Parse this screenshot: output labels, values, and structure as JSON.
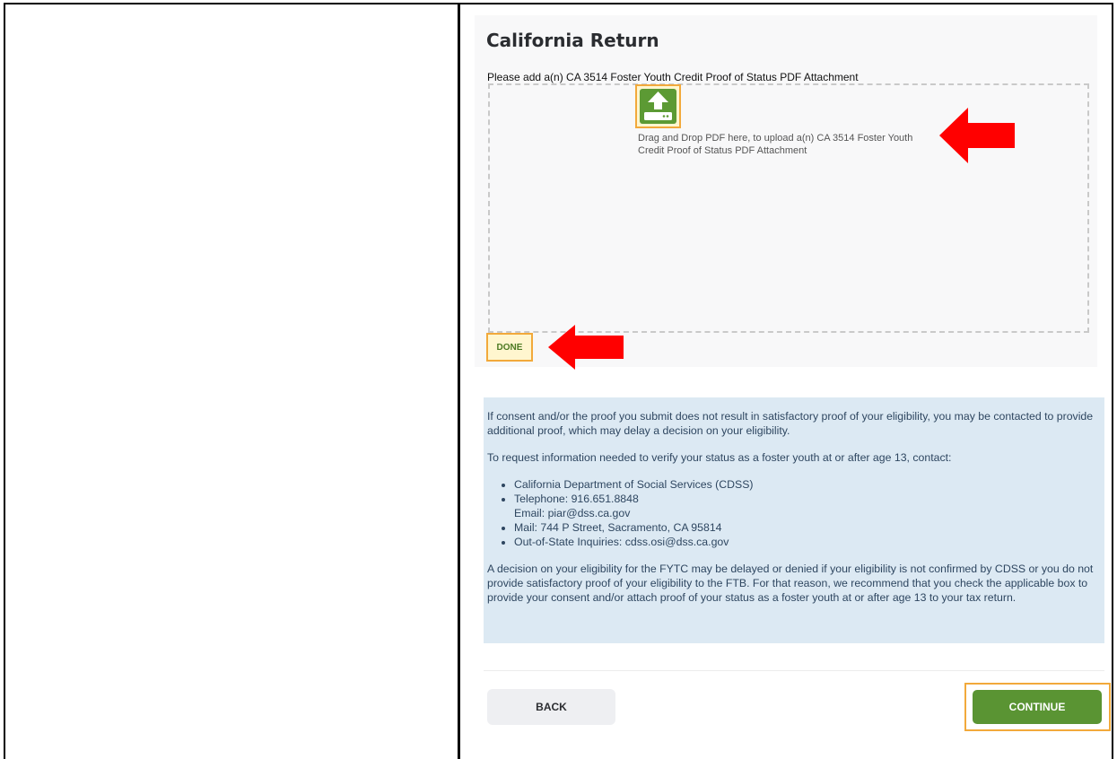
{
  "page": {
    "title": "California Return",
    "instruction": "Please add a(n) CA 3514 Foster Youth Credit Proof of Status PDF Attachment"
  },
  "upload": {
    "icon": "upload-icon",
    "drop_text": "Drag and Drop PDF here, to upload a(n) CA 3514 Foster Youth Credit Proof of Status PDF Attachment",
    "done_label": "DONE"
  },
  "info": {
    "paragraph1": "If consent and/or the proof you submit does not result in satisfactory proof of your eligibility, you may be contacted to provide additional proof, which may delay a decision on your eligibility.",
    "paragraph2": "To request information needed to verify your status as a foster youth at or after age 13, contact:",
    "contacts": {
      "agency": "California Department of Social Services (CDSS)",
      "telephone": "Telephone: 916.651.8848",
      "email": "Email: piar@dss.ca.gov",
      "mail": "Mail: 744 P Street, Sacramento, CA 95814",
      "out_of_state": "Out-of-State Inquiries: cdss.osi@dss.ca.gov"
    },
    "paragraph3": "A decision on your eligibility for the FYTC may be delayed or denied if your eligibility is not confirmed by CDSS or you do not provide satisfactory proof of your eligibility to the FTB. For that reason, we recommend that you check the applicable box to provide your consent and/or attach proof of your status as a foster youth at or after age 13 to your tax return."
  },
  "footer": {
    "back_label": "BACK",
    "continue_label": "CONTINUE"
  },
  "colors": {
    "accent_green": "#5a9433",
    "highlight_orange": "#f2a93b",
    "info_background": "#dce9f3",
    "annotation_red": "#ff0000"
  }
}
